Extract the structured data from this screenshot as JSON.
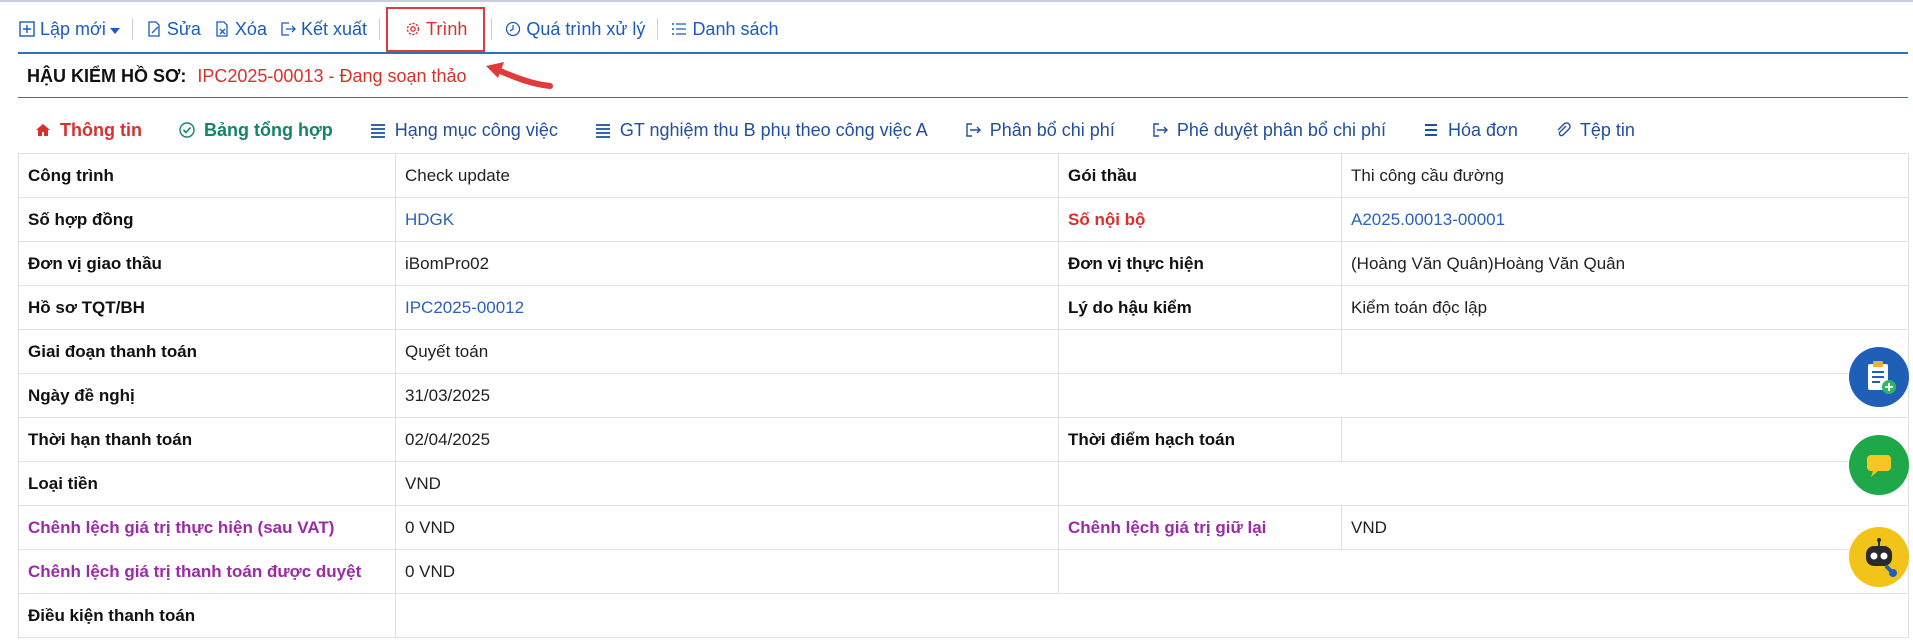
{
  "toolbar": {
    "new_label": "Lập mới",
    "edit_label": "Sửa",
    "delete_label": "Xóa",
    "export_label": "Kết xuất",
    "submit_label": "Trình",
    "process_label": "Quá trình xử lý",
    "list_label": "Danh sách"
  },
  "record": {
    "heading": "HẬU KIỂM HỒ SƠ:",
    "value": "IPC2025-00013 - Đang soạn thảo"
  },
  "tabs": [
    {
      "label": "Thông tin"
    },
    {
      "label": "Bảng tổng hợp"
    },
    {
      "label": "Hạng mục công việc"
    },
    {
      "label": "GT nghiệm thu B phụ theo công việc A"
    },
    {
      "label": "Phân bổ chi phí"
    },
    {
      "label": "Phê duyệt phân bổ chi phí"
    },
    {
      "label": "Hóa đơn"
    },
    {
      "label": "Tệp tin"
    }
  ],
  "fields": {
    "cong_trinh": {
      "label": "Công trình",
      "value": "Check update"
    },
    "goi_thau": {
      "label": "Gói thầu",
      "value": "Thi công cầu đường"
    },
    "so_hop_dong": {
      "label": "Số hợp đồng",
      "value": "HDGK"
    },
    "so_noi_bo": {
      "label": "Số nội bộ",
      "value": "A2025.00013-00001"
    },
    "don_vi_giao_thau": {
      "label": "Đơn vị giao thầu",
      "value": "iBomPro02"
    },
    "don_vi_thuc_hien": {
      "label": "Đơn vị thực hiện",
      "value": "(Hoàng Văn Quân)Hoàng Văn Quân"
    },
    "ho_so_tqt": {
      "label": "Hồ sơ TQT/BH",
      "value": "IPC2025-00012"
    },
    "ly_do_hau_kiem": {
      "label": "Lý do hậu kiểm",
      "value": "Kiểm toán độc lập"
    },
    "giai_doan": {
      "label": "Giai đoạn thanh toán",
      "value": "Quyết toán"
    },
    "ngay_de_nghi": {
      "label": "Ngày đề nghị",
      "value": "31/03/2025"
    },
    "thoi_han": {
      "label": "Thời hạn thanh toán",
      "value": "02/04/2025"
    },
    "thoi_diem_hach_toan": {
      "label": "Thời điểm hạch toán",
      "value": ""
    },
    "loai_tien": {
      "label": "Loại tiền",
      "value": "VND"
    },
    "chenh_lech_thuc_hien": {
      "label": "Chênh lệch giá trị thực hiện (sau VAT)",
      "value": "0 VND"
    },
    "chenh_lech_giu_lai": {
      "label": "Chênh lệch giá trị giữ lại",
      "value": "VND"
    },
    "chenh_lech_duyet": {
      "label": "Chênh lệch giá trị thanh toán được duyệt",
      "value": "0 VND"
    },
    "dieu_kien": {
      "label": "Điều kiện thanh toán",
      "value": ""
    }
  },
  "colors": {
    "link": "#1a5bbf",
    "accent_red": "#d9302b",
    "purple": "#9b2aa6",
    "green": "#13836b"
  },
  "floating": [
    "clipboard-add-icon",
    "chat-icon",
    "robot-support-icon"
  ]
}
